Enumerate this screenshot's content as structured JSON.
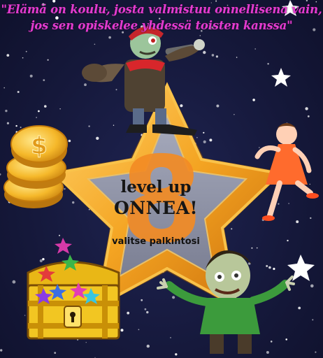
{
  "quote": {
    "line1": "\"Elämä on koulu, josta valmistuu onnellisena vain,",
    "line2": "jos sen opiskelee yhdessä toisten kanssa\""
  },
  "badge": {
    "level_number": "8",
    "level_up": "level up",
    "congrats": "ONNEA!",
    "choose_reward": "valitse palkintosi"
  },
  "rewards": [
    "coins-stack",
    "dancing-girl",
    "treasure-chest",
    "zombie-boy"
  ],
  "colors": {
    "background": "#15183a",
    "star_gold": "#f2a721",
    "star_inner": "#8f93a8",
    "number_orange": "#f28b24",
    "quote_magenta": "#e43bd0"
  }
}
